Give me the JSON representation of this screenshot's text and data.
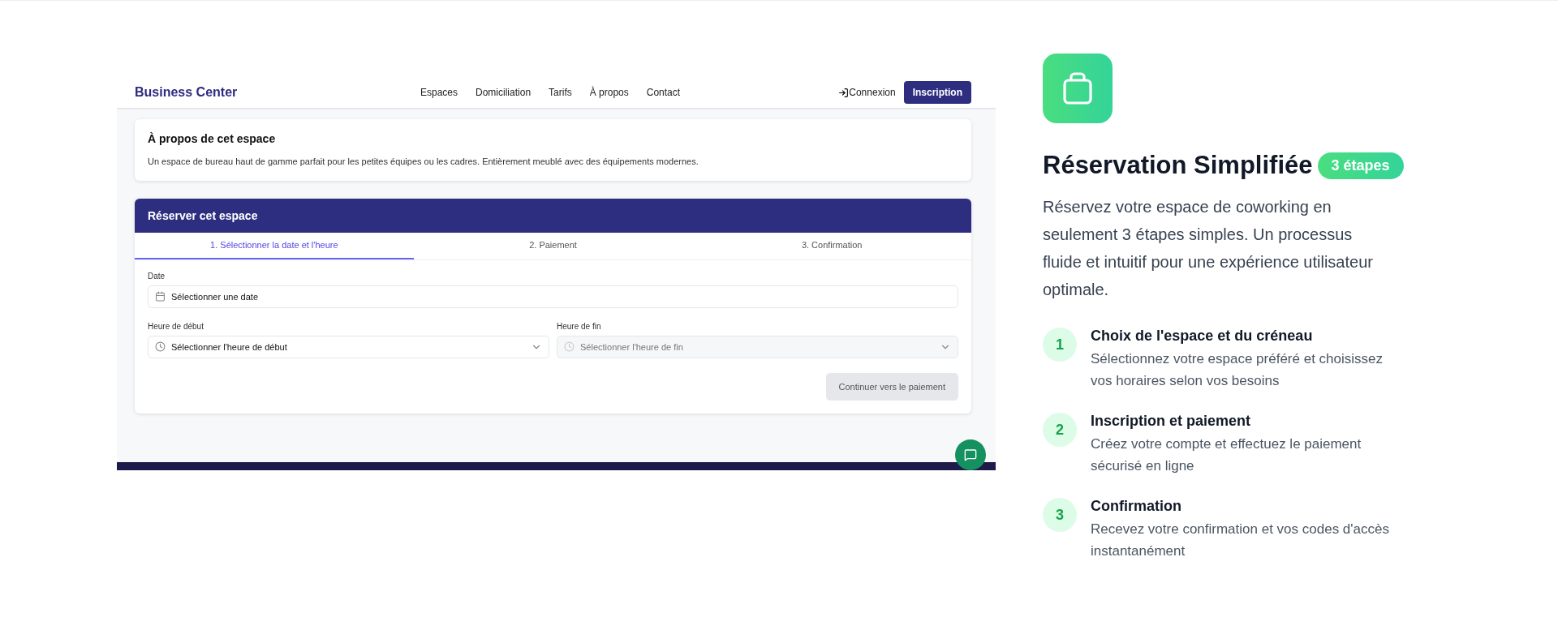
{
  "preview": {
    "navbar": {
      "logo": "Business Center",
      "links": [
        "Espaces",
        "Domiciliation",
        "Tarifs",
        "À propos",
        "Contact"
      ],
      "login": "Connexion",
      "signup": "Inscription"
    },
    "about": {
      "title": "À propos de cet espace",
      "text": "Un espace de bureau haut de gamme parfait pour les petites équipes ou les cadres. Entièrement meublé avec des équipements modernes."
    },
    "booking": {
      "title": "Réserver cet espace",
      "tabs": [
        {
          "label": "1. Sélectionner la date et l'heure",
          "selected": true
        },
        {
          "label": "2. Paiement",
          "selected": false
        },
        {
          "label": "3. Confirmation",
          "selected": false
        }
      ],
      "date": {
        "label": "Date",
        "placeholder": "Sélectionner une date"
      },
      "start": {
        "label": "Heure de début",
        "placeholder": "Sélectionner l'heure de début",
        "disabled": false
      },
      "end": {
        "label": "Heure de fin",
        "placeholder": "Sélectionner l'heure de fin",
        "disabled": true
      },
      "continue": {
        "label": "Continuer vers le paiement",
        "disabled": true
      }
    }
  },
  "feature": {
    "title": "Réservation Simplifiée",
    "badge": "3 étapes",
    "description": "Réservez votre espace de coworking en seulement 3 étapes simples. Un processus fluide et intuitif pour une expérience utilisateur optimale.",
    "steps": [
      {
        "number": "1",
        "title": "Choix de l'espace et du créneau",
        "text": "Sélectionnez votre espace préféré et choisissez vos horaires selon vos besoins"
      },
      {
        "number": "2",
        "title": "Inscription et paiement",
        "text": "Créez votre compte et effectuez le paiement sécurisé en ligne"
      },
      {
        "number": "3",
        "title": "Confirmation",
        "text": "Recevez votre confirmation et vos codes d'accès instantanément"
      }
    ]
  }
}
